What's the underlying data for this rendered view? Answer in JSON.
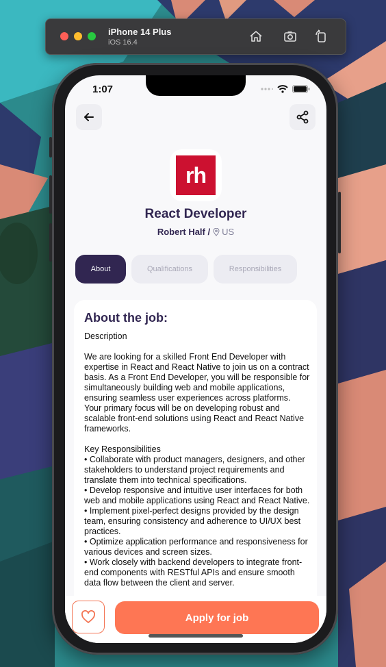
{
  "simulator": {
    "device_name": "iPhone 14 Plus",
    "os_version": "iOS 16.4",
    "buttons": [
      "home-icon",
      "screenshot-icon",
      "rotate-icon"
    ]
  },
  "status_bar": {
    "time": "1:07",
    "icons": [
      "signal-dots-icon",
      "wifi-icon",
      "battery-icon"
    ]
  },
  "header": {
    "back_icon": "arrow-left-icon",
    "share_icon": "share-icon"
  },
  "company": {
    "logo_text": "rh",
    "logo_color": "#cc1130"
  },
  "job": {
    "title": "React Developer",
    "company_name": "Robert Half /",
    "location": "US"
  },
  "tabs": [
    {
      "label": "About",
      "active": true
    },
    {
      "label": "Qualifications",
      "active": false
    },
    {
      "label": "Responsibilities",
      "active": false
    }
  ],
  "about": {
    "heading": "About the job:",
    "text": "Description\n\nWe are looking for a skilled Front End Developer with expertise in React and React Native to join us on a contract basis. As a Front End Developer, you will be responsible for simultaneously building web and mobile applications, ensuring seamless user experiences across platforms. Your primary focus will be on developing robust and scalable front-end solutions using React and React Native frameworks.\n\nKey Responsibilities\n• Collaborate with product managers, designers, and other stakeholders to understand project requirements and translate them into technical specifications.\n• Develop responsive and intuitive user interfaces for both web and mobile applications using React and React Native.\n• Implement pixel-perfect designs provided by the design team, ensuring consistency and adherence to UI/UX best practices.\n• Optimize application performance and responsiveness for various devices and screen sizes.\n• Work closely with backend developers to integrate front-end components with RESTful APIs and ensure smooth data flow between the client and server."
  },
  "footer": {
    "favorite_icon": "heart-outline-icon",
    "apply_label": "Apply for job"
  },
  "colors": {
    "primary": "#312651",
    "accent": "#fe7654",
    "tab_inactive_bg": "#ececf2",
    "tab_inactive_text": "#aaa9b8"
  }
}
